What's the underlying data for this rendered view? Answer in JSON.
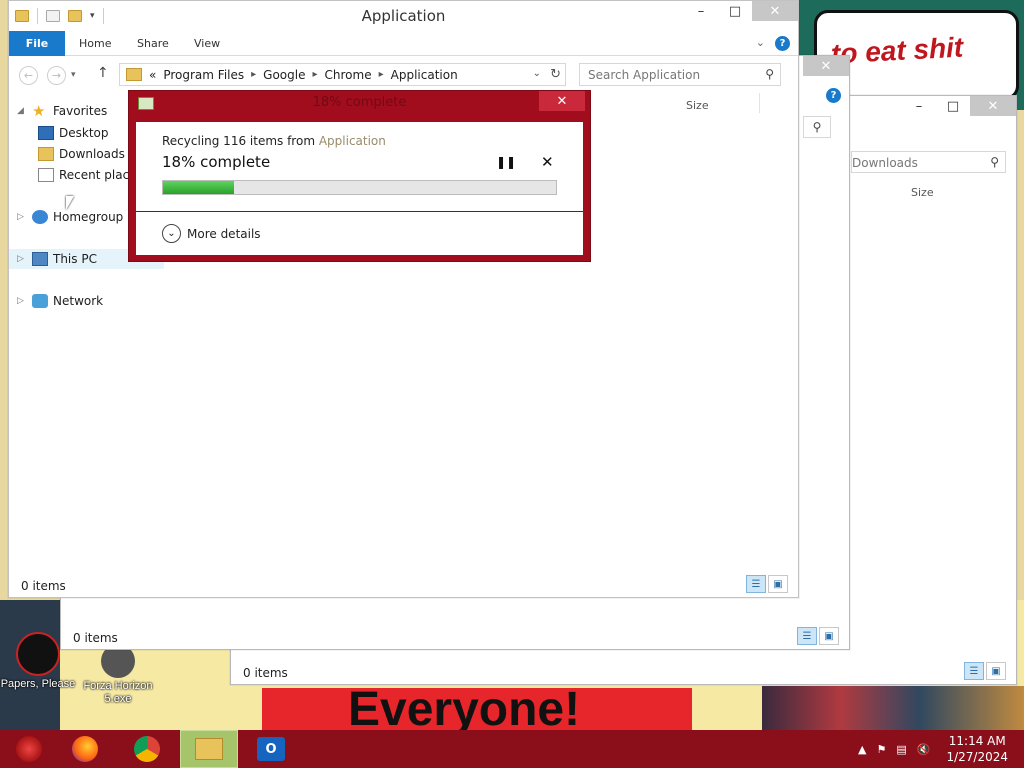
{
  "wallpaper": {
    "bubble_text": "to eat shit",
    "banner_text": "Everyone!",
    "desktop_icons": [
      {
        "label": "Papers, Please",
        "name": "papers-please"
      },
      {
        "label": "Forza Horizon 5.exe",
        "name": "forza-horizon"
      }
    ]
  },
  "back_windows": [
    {
      "status": "0 items",
      "search_placeholder": "Downloads",
      "column": "Size"
    },
    {
      "status": "0 items"
    }
  ],
  "main": {
    "title": "Application",
    "ribbon": {
      "file": "File",
      "home": "Home",
      "share": "Share",
      "view": "View"
    },
    "breadcrumb": {
      "overflow": "«",
      "items": [
        "Program Files",
        "Google",
        "Chrome",
        "Application"
      ]
    },
    "search_placeholder": "Search Application",
    "nav": {
      "favorites": "Favorites",
      "desktop": "Desktop",
      "downloads": "Downloads",
      "recent": "Recent places",
      "homegroup": "Homegroup",
      "this_pc": "This PC",
      "network": "Network"
    },
    "column_size": "Size",
    "status": "0 items"
  },
  "dialog": {
    "title": "18% complete",
    "line1_prefix": "Recycling 116 items from ",
    "line1_source": "Application",
    "percent_text": "18% complete",
    "progress": 0.18,
    "more_details": "More details"
  },
  "taskbar": {
    "apps": [
      "firefox",
      "chrome",
      "file-explorer",
      "outlook"
    ],
    "clock_time": "11:14 AM",
    "clock_date": "1/27/2024"
  },
  "colors": {
    "dialog_frame": "#a20d1d",
    "taskbar": "#8a0f1a",
    "accent": "#1979ca",
    "progress": "#2aa22a"
  }
}
